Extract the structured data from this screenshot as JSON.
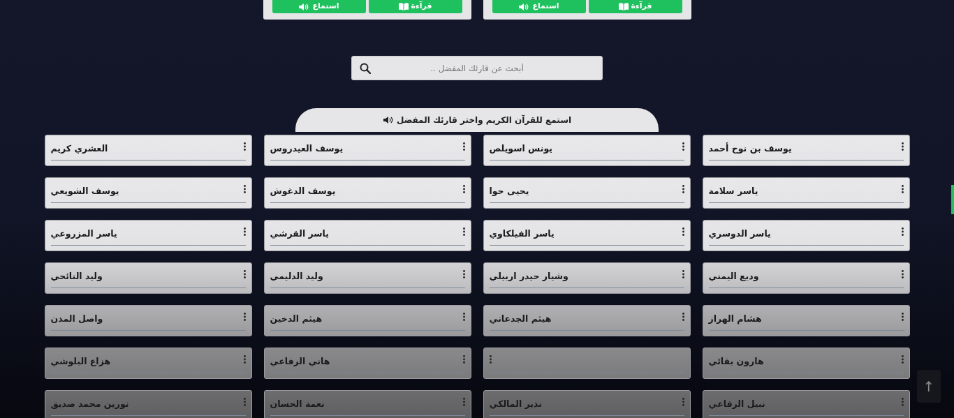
{
  "top_cards": [
    {
      "buttons": [
        {
          "label": "قرآءة",
          "kind": "read"
        },
        {
          "label": "استماع",
          "kind": "listen"
        }
      ]
    },
    {
      "buttons": [
        {
          "label": "قرآءة",
          "kind": "read"
        },
        {
          "label": "استماع",
          "kind": "listen"
        }
      ]
    }
  ],
  "search": {
    "placeholder": "أبحث عن قارئك المفضل .."
  },
  "section_title": "استمع للقرآن الكريم واختر قارئك المفضل",
  "reciters": [
    {
      "name": "يوسف بن نوح أحمد"
    },
    {
      "name": "يونس اسويلص"
    },
    {
      "name": "يوسف العيدروس"
    },
    {
      "name": "العشري كريم"
    },
    {
      "name": "ياسر سلامة"
    },
    {
      "name": "يحيى حوا"
    },
    {
      "name": "يوسف الدغوش"
    },
    {
      "name": "يوسف الشويعي"
    },
    {
      "name": "ياسر الدوسري"
    },
    {
      "name": "ياسر الفيلكاوي"
    },
    {
      "name": "ياسر القرشي"
    },
    {
      "name": "ياسر المزروعي"
    },
    {
      "name": "وديع اليمني"
    },
    {
      "name": "وشيار حيدر اربيلي"
    },
    {
      "name": "وليد الدليمي"
    },
    {
      "name": "وليد النائحي"
    },
    {
      "name": "هشام الهراز"
    },
    {
      "name": "هيثم الجدعاني"
    },
    {
      "name": "هيثم الدخين"
    },
    {
      "name": "واصل المذن"
    },
    {
      "name": "هارون بقائي"
    },
    {
      "kind": "blank"
    },
    {
      "name": "هاني الرفاعي"
    },
    {
      "name": "هزاع البلوشي"
    },
    {
      "name": "نبيل الرفاعي"
    },
    {
      "name": "نذير المالكي"
    },
    {
      "name": "نعمة الحسان"
    },
    {
      "name": "نورين محمد صديق"
    }
  ],
  "back_to_top": "↑"
}
